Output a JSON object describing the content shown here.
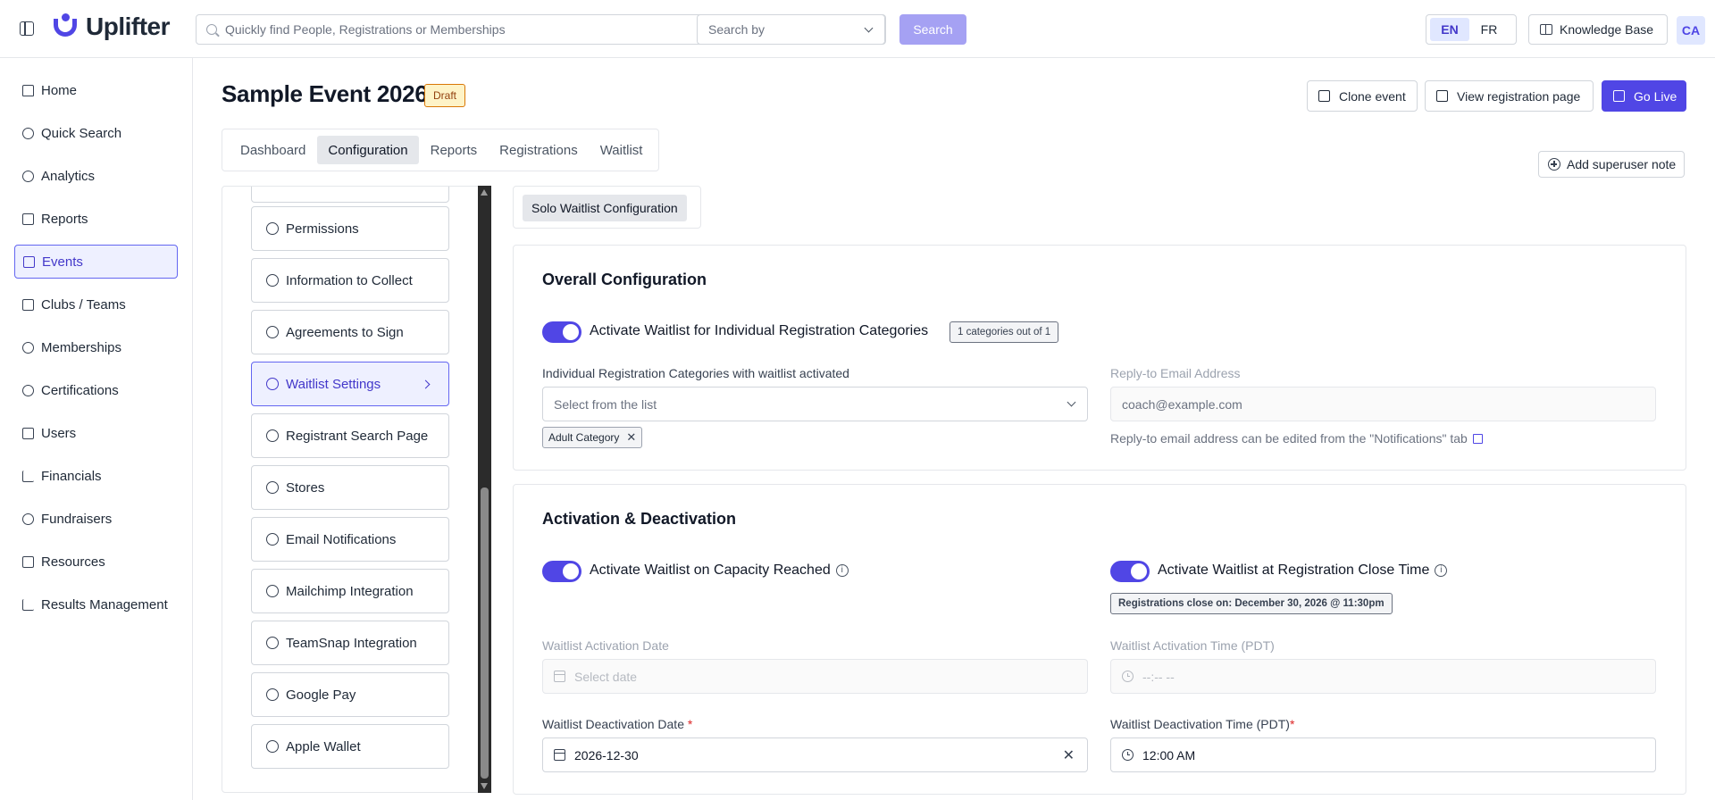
{
  "app": {
    "logo_text": "Uplifter",
    "search_placeholder": "Quickly find People, Registrations or Memberships",
    "search_by_placeholder": "Search by",
    "search_button": "Search",
    "languages": [
      "EN",
      "FR"
    ],
    "active_language": "EN",
    "knowledge_base": "Knowledge Base",
    "avatar_initials": "CA"
  },
  "sidebar": {
    "items": [
      {
        "label": "Home",
        "icon": "home-icon"
      },
      {
        "label": "Quick Search",
        "icon": "search-icon"
      },
      {
        "label": "Analytics",
        "icon": "pie-chart-icon"
      },
      {
        "label": "Reports",
        "icon": "document-icon"
      },
      {
        "label": "Events",
        "icon": "calendar-icon",
        "active": true
      },
      {
        "label": "Clubs / Teams",
        "icon": "building-icon"
      },
      {
        "label": "Memberships",
        "icon": "users-icon"
      },
      {
        "label": "Certifications",
        "icon": "graduation-cap-icon"
      },
      {
        "label": "Users",
        "icon": "user-card-icon"
      },
      {
        "label": "Financials",
        "icon": "bar-chart-icon"
      },
      {
        "label": "Fundraisers",
        "icon": "handshake-icon"
      },
      {
        "label": "Resources",
        "icon": "book-icon"
      },
      {
        "label": "Results Management",
        "icon": "list-chart-icon"
      }
    ]
  },
  "event": {
    "title": "Sample Event 2026",
    "status": "Draft",
    "actions": {
      "clone": "Clone event",
      "view": "View registration page",
      "go_live": "Go Live"
    },
    "tabs": [
      "Dashboard",
      "Configuration",
      "Reports",
      "Registrations",
      "Waitlist"
    ],
    "active_tab": "Configuration",
    "superuser_note": "Add superuser note"
  },
  "config_list": {
    "items": [
      {
        "label": "Permissions"
      },
      {
        "label": "Information to Collect"
      },
      {
        "label": "Agreements to Sign"
      },
      {
        "label": "Waitlist Settings",
        "active": true
      },
      {
        "label": "Registrant Search Page"
      },
      {
        "label": "Stores"
      },
      {
        "label": "Email Notifications"
      },
      {
        "label": "Mailchimp Integration"
      },
      {
        "label": "TeamSnap Integration"
      },
      {
        "label": "Google Pay"
      },
      {
        "label": "Apple Wallet"
      }
    ]
  },
  "waitlist": {
    "sub_tab": "Solo Waitlist Configuration",
    "overall": {
      "title": "Overall Configuration",
      "toggle_label": "Activate Waitlist for Individual Registration Categories",
      "toggle_on": true,
      "count_badge": "1 categories out of 1",
      "categories_label": "Individual Registration Categories with waitlist activated",
      "categories_placeholder": "Select from the list",
      "selected_chip": "Adult Category",
      "reply_to_label": "Reply-to Email Address",
      "reply_to_placeholder": "coach@example.com",
      "reply_to_help": "Reply-to email address can be edited from the \"Notifications\" tab"
    },
    "activation": {
      "title": "Activation & Deactivation",
      "capacity_toggle_label": "Activate Waitlist on Capacity Reached",
      "capacity_toggle_on": true,
      "close_toggle_label": "Activate Waitlist at Registration Close Time",
      "close_toggle_on": true,
      "close_badge": "Registrations close on: December 30, 2026 @ 11:30pm",
      "activation_date_label": "Waitlist Activation Date",
      "activation_date_placeholder": "Select date",
      "activation_time_label": "Waitlist Activation Time (PDT)",
      "activation_time_placeholder": "--:-- --",
      "deactivation_date_label": "Waitlist Deactivation Date",
      "deactivation_date_value": "2026-12-30",
      "deactivation_time_label": "Waitlist Deactivation Time (PDT)",
      "deactivation_time_value": "12:00 AM",
      "required_mark": "*"
    }
  },
  "colors": {
    "brand": "#5046e5",
    "draft_border": "#d97706",
    "active_nav_bg": "#eef0ff"
  }
}
